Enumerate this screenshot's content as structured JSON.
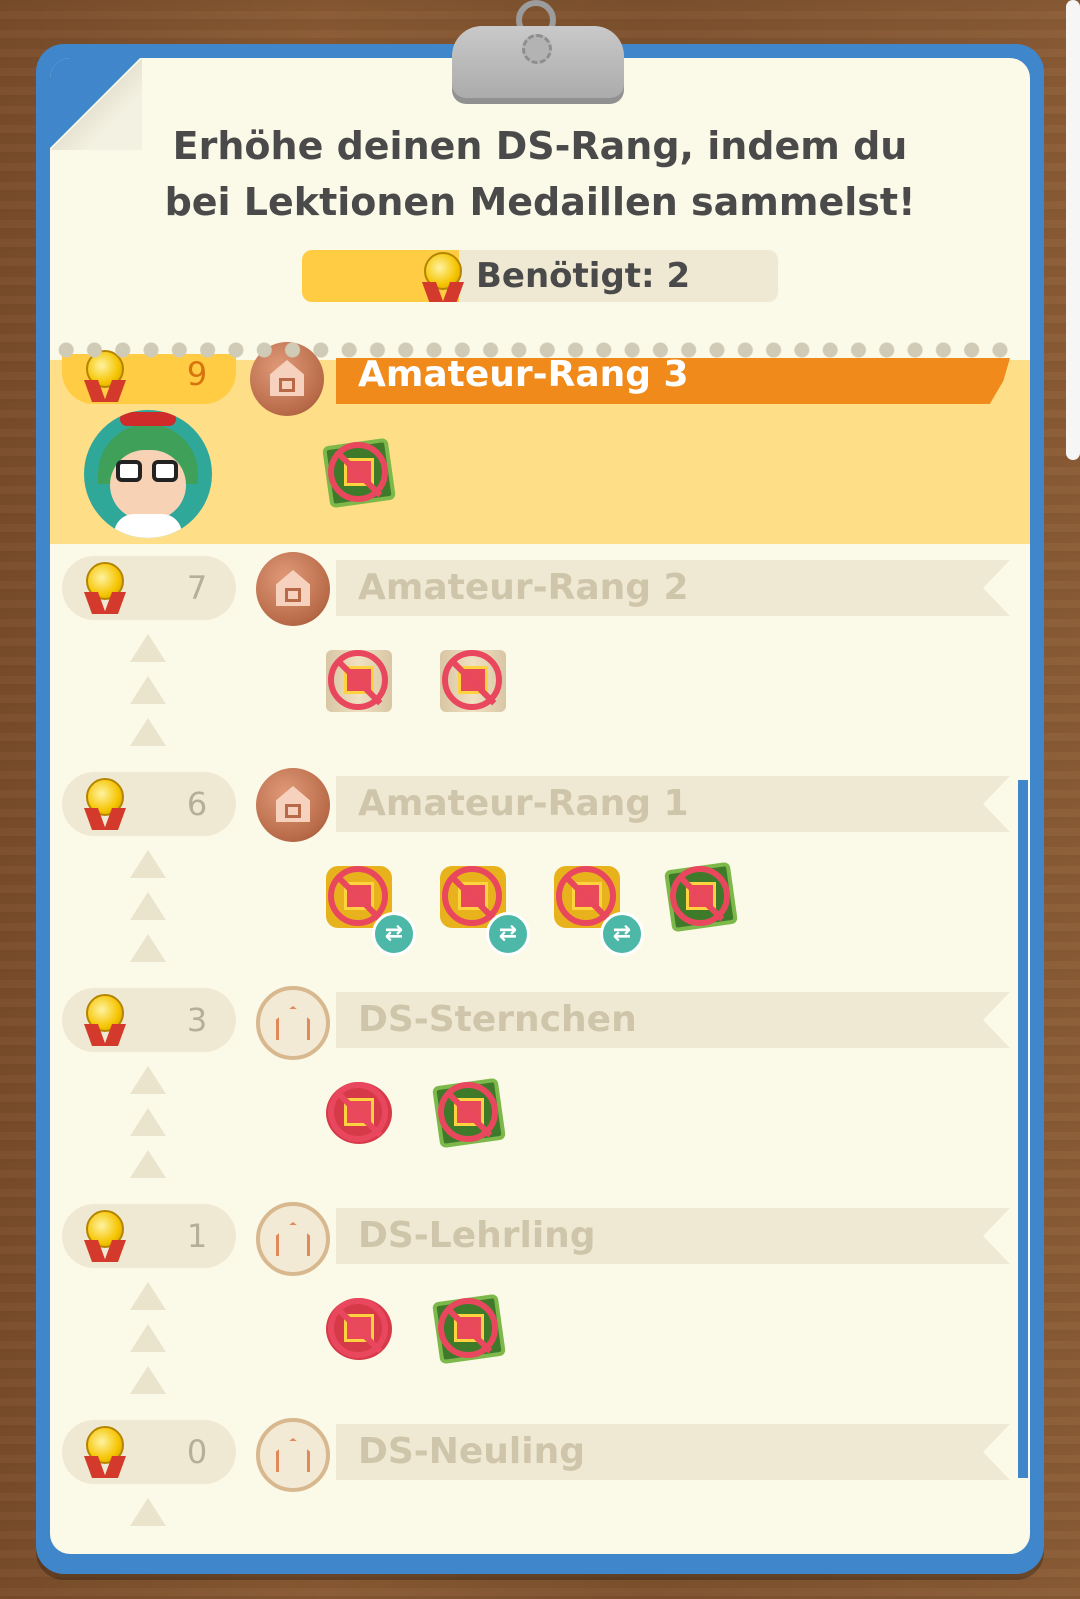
{
  "header": {
    "line1": "Erhöhe deinen DS-Rang, indem du",
    "line2": "bei Lektionen Medaillen sammelst!"
  },
  "progress": {
    "label": "Benötigt: 2",
    "fill_fraction": 0.33,
    "fill_color": "#ffcc44"
  },
  "current_rank": {
    "medals": "9",
    "title": "Amateur-Rang 3",
    "banner_color": "#f08a1a",
    "highlight_color": "#ffde88",
    "rewards": [
      "bill-gift-icon"
    ]
  },
  "ranks": [
    {
      "medals": "7",
      "title": "Amateur-Rang 2",
      "badge": "bronze-house-icon",
      "rewards": [
        "scroll-gift-icon",
        "scroll-gift-icon"
      ]
    },
    {
      "medals": "6",
      "title": "Amateur-Rang 1",
      "badge": "bronze-house-icon",
      "rewards": [
        "furniture-gift-icon",
        "furniture-gift-icon",
        "furniture-gift-icon",
        "bill-gift-icon"
      ]
    },
    {
      "medals": "3",
      "title": "DS-Sternchen",
      "badge": "paper-house-icon",
      "rewards": [
        "red-gift-icon",
        "bill-gift-icon"
      ]
    },
    {
      "medals": "1",
      "title": "DS-Lehrling",
      "badge": "paper-house-icon",
      "rewards": [
        "red-gift-icon",
        "bill-gift-icon"
      ]
    },
    {
      "medals": "0",
      "title": "DS-Neuling",
      "badge": "paper-house-icon",
      "rewards": []
    }
  ]
}
